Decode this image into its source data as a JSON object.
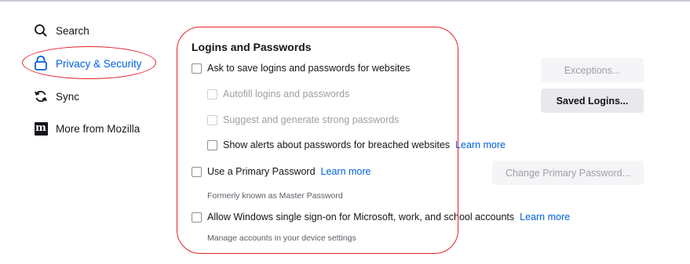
{
  "sidebar": {
    "search": {
      "label": "Search",
      "icon": "search-icon"
    },
    "privacy": {
      "label": "Privacy & Security",
      "icon": "lock-icon",
      "active": true
    },
    "sync": {
      "label": "Sync",
      "icon": "sync-icon"
    },
    "more": {
      "label": "More from Mozilla",
      "icon": "mozilla-logo-icon",
      "logo_text": "m"
    }
  },
  "logins": {
    "title": "Logins and Passwords",
    "ask_to_save": "Ask to save logins and passwords for websites",
    "autofill": "Autofill logins and passwords",
    "suggest": "Suggest and generate strong passwords",
    "breach_alerts": "Show alerts about passwords for breached websites",
    "breach_learn_more": "Learn more",
    "primary_password": "Use a Primary Password",
    "primary_learn_more": "Learn more",
    "primary_hint": "Formerly known as Master Password",
    "windows_sso": "Allow Windows single sign-on for Microsoft, work, and school accounts",
    "sso_learn_more": "Learn more",
    "sso_hint": "Manage accounts in your device settings",
    "exceptions_button": "Exceptions...",
    "saved_logins_button": "Saved Logins...",
    "change_primary_button": "Change Primary Password..."
  },
  "colors": {
    "accent": "#0060df",
    "annotation": "#e8212c"
  }
}
